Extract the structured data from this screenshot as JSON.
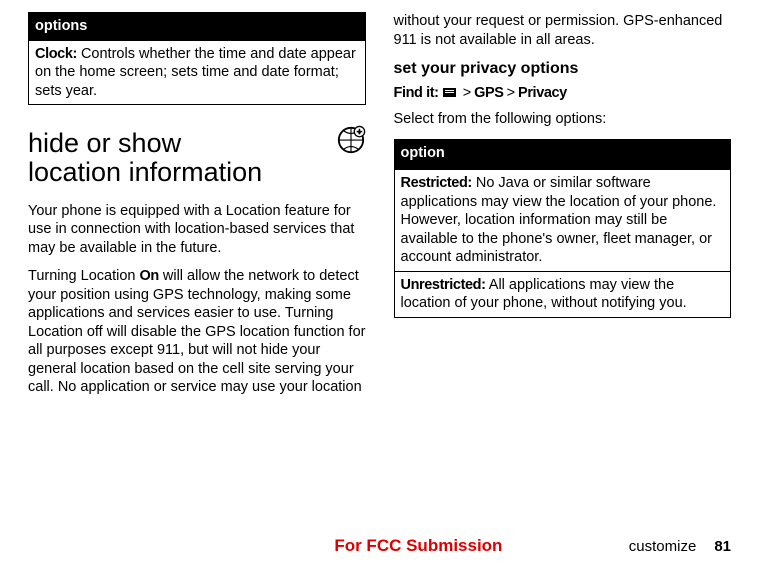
{
  "left": {
    "options_table": {
      "head": "options",
      "row_label": "Clock:",
      "row_text": " Controls whether the time and date appear on the home screen; sets time and date format; sets year."
    },
    "section_heading_a": "hide or show",
    "section_heading_b": "location information",
    "para1": "Your phone is equipped with a Location feature for use in connection with location-based services that may be available in the future.",
    "para2_a": "Turning Location ",
    "para2_on": "On",
    "para2_b": " will allow the network to detect your position using GPS technology, making some applications and services easier to use. Turning Location off will disable the GPS location function for all purposes except 911, but will not hide your general location based on the cell site serving your call. No application or service may use your location"
  },
  "right": {
    "top_para": "without your request or permission. GPS-enhanced 911 is not available in all areas.",
    "subsection": "set your privacy options",
    "findit_label": "Find it:",
    "findit_gps": "GPS",
    "findit_privacy": "Privacy",
    "select_text": "Select from the following options:",
    "option_table": {
      "head": "option",
      "r1_label": "Restricted:",
      "r1_text": " No Java or similar software applications may view the location of your phone. However, location information may still be available to the phone's owner, fleet manager, or account administrator.",
      "r2_label": "Unrestricted:",
      "r2_text": " All applications may view the location of your phone, without notifying you."
    }
  },
  "footer": {
    "center": "For FCC Submission",
    "label": "customize",
    "page": "81"
  }
}
